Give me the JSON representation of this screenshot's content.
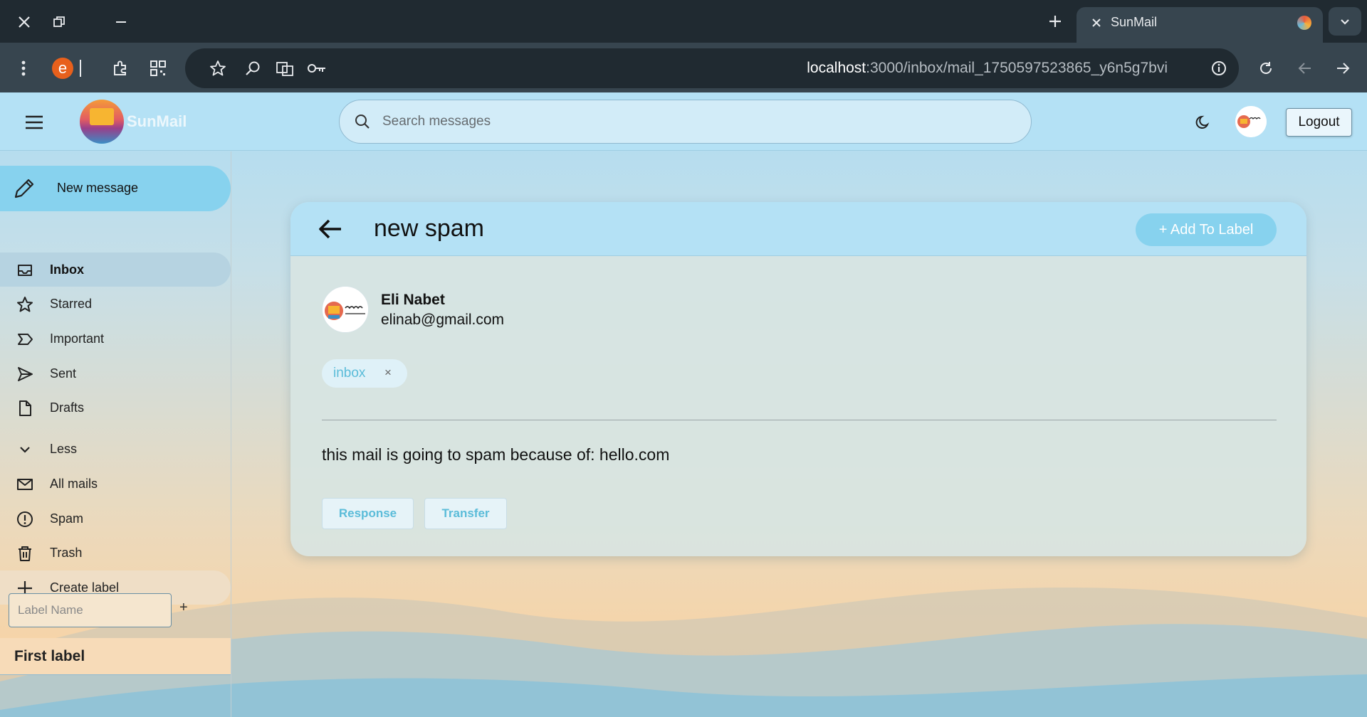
{
  "browser": {
    "tab_title": "SunMail",
    "url_host": "localhost",
    "url_path": ":3000/inbox/mail_1750597523865_y6n5g7bvi",
    "extension_letter": "e"
  },
  "app": {
    "logo_text": "SunMail",
    "search_placeholder": "Search messages",
    "logout_label": "Logout"
  },
  "sidebar": {
    "compose_label": "New message",
    "items": [
      {
        "label": "Inbox",
        "icon": "inbox-icon",
        "active": true
      },
      {
        "label": "Starred",
        "icon": "star-icon"
      },
      {
        "label": "Important",
        "icon": "important-icon"
      },
      {
        "label": "Sent",
        "icon": "send-icon"
      },
      {
        "label": "Drafts",
        "icon": "draft-icon"
      },
      {
        "label": "Less",
        "icon": "chevron-down-icon"
      },
      {
        "label": "All mails",
        "icon": "mail-icon"
      },
      {
        "label": "Spam",
        "icon": "spam-icon"
      },
      {
        "label": "Trash",
        "icon": "trash-icon"
      },
      {
        "label": "Create label",
        "icon": "plus-icon"
      }
    ],
    "label_input_placeholder": "Label Name",
    "label_add_symbol": "+",
    "user_labels": [
      "First label"
    ]
  },
  "mail": {
    "subject": "new spam",
    "add_label_button": "+ Add To Label",
    "sender_name": "Eli Nabet",
    "sender_email": "elinab@gmail.com",
    "labels": [
      {
        "name": "inbox",
        "remove_symbol": "×"
      }
    ],
    "body": "this mail is going to spam because of: hello.com",
    "actions": {
      "response": "Response",
      "transfer": "Transfer"
    }
  },
  "colors": {
    "accent": "#87d2ee",
    "header_bg": "#b4e1f5",
    "chrome_dark": "#202a31",
    "chrome_mid": "#37454f"
  }
}
